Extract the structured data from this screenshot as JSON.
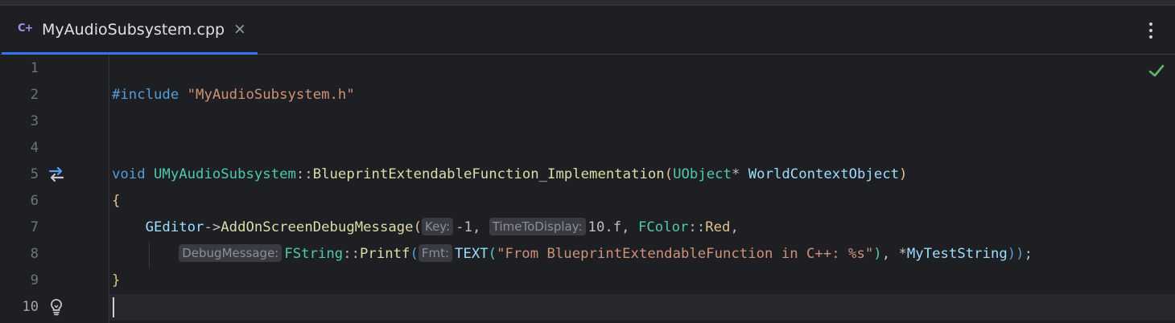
{
  "tab": {
    "icon_text": "C+",
    "title": "MyAudioSubsystem.cpp",
    "close_glyph": "×"
  },
  "colors": {
    "accent": "#3574f0",
    "keyword": "#569cd6",
    "string": "#ce9178",
    "class": "#4ec9b0",
    "function": "#dcdcaa",
    "ok_check": "#5fb865"
  },
  "editor": {
    "line_numbers": [
      "1",
      "2",
      "3",
      "4",
      "5",
      "6",
      "7",
      "8",
      "9",
      "10"
    ],
    "current_line": 10,
    "gutter_icons": {
      "line5": "implementation-arrows-icon",
      "line10": "lightbulb-icon"
    },
    "status_icon": "checkmark-icon",
    "code": {
      "l2_directive": "#include",
      "l2_string": "\"MyAudioSubsystem.h\"",
      "l5_void": "void",
      "l5_class": "UMyAudioSubsystem",
      "l5_sep": "::",
      "l5_func": "BlueprintExtendableFunction_Implementation",
      "l5_paren_open": "(",
      "l5_type": "UObject",
      "l5_star": "*",
      "l5_param": "WorldContextObject",
      "l5_paren_close": ")",
      "l6_brace": "{",
      "l7_obj": "GEditor",
      "l7_arrow": "->",
      "l7_func": "AddOnScreenDebugMessage",
      "l7_paren": "(",
      "l7_hint_key": "Key:",
      "l7_key_val": "-1,",
      "l7_hint_time": "TimeToDisplay:",
      "l7_time_val": "10.f,",
      "l7_fcolor": "FColor",
      "l7_sep": "::",
      "l7_red": "Red",
      "l7_comma": ",",
      "l8_hint_msg": "DebugMessage:",
      "l8_fstring": "FString",
      "l8_sep": "::",
      "l8_printf": "Printf",
      "l8_paren": "(",
      "l8_hint_fmt": "Fmt:",
      "l8_text": "TEXT",
      "l8_text_paren": "(",
      "l8_string": "\"From BlueprintExtendableFunction in C++: %s\"",
      "l8_close1": ")",
      "l8_comma_star": ", *",
      "l8_var": "MyTestString",
      "l8_close2": "))",
      "l8_semi": ";",
      "l9_brace": "}"
    }
  }
}
